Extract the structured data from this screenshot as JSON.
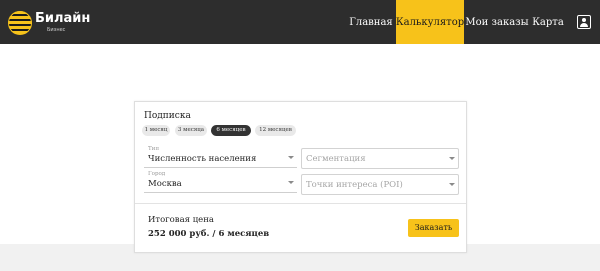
{
  "header": {
    "brand_name": "Билайн",
    "brand_sub": "Бизнес",
    "nav": {
      "home": "Главная",
      "calculator": "Калькулятор",
      "orders": "Мои заказы",
      "map": "Карта"
    },
    "active_nav": "calculator",
    "accent_color": "#f7c21a",
    "bar_color": "#2d2d2d",
    "user_icon": "account-icon"
  },
  "card": {
    "title": "Подписка",
    "periods": [
      "1 месяц",
      "3 месяца",
      "6 месяцев",
      "12 месяцев"
    ],
    "selected_period": "6 месяцев",
    "fields": {
      "type": {
        "label": "Тип",
        "value": "Численность населения"
      },
      "segmentation": {
        "placeholder": "Сегментация"
      },
      "city": {
        "label": "Город",
        "value": "Москва"
      },
      "poi": {
        "placeholder": "Точки интереса (POI)"
      }
    },
    "total_label": "Итоговая цена",
    "total_price": "252 000 руб. / 6 месяцев",
    "order_button": "Заказать"
  }
}
